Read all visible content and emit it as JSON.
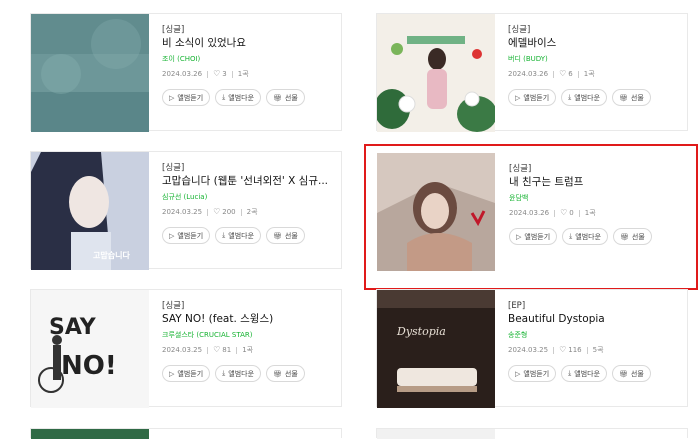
{
  "albums": [
    {
      "type": "[싱글]",
      "title": "비 소식이 있었나요",
      "artist": "조이 (CHOI)",
      "date": "2024.03.26",
      "likes": "3",
      "tracks": "1곡",
      "cover_art": "rain-cover"
    },
    {
      "type": "[싱글]",
      "title": "에델바이스",
      "artist": "버디 (BUDY)",
      "date": "2024.03.26",
      "likes": "6",
      "tracks": "1곡",
      "cover_art": "flower-cover"
    },
    {
      "type": "[싱글]",
      "title": "고맙습니다 (웹툰 '선녀외전' X 심규...",
      "artist": "심규선 (Lucia)",
      "date": "2024.03.25",
      "likes": "200",
      "tracks": "2곡",
      "cover_art": "webtoon-cover"
    },
    {
      "type": "[싱글]",
      "title": "내 친구는 트럼프",
      "artist": "윤담백",
      "date": "2024.03.26",
      "likes": "0",
      "tracks": "1곡",
      "cover_art": "portrait-cover"
    },
    {
      "type": "[싱글]",
      "title": "SAY NO! (feat. 스윙스)",
      "artist": "크루셜스타 (CRUCIAL STAR)",
      "date": "2024.03.25",
      "likes": "81",
      "tracks": "1곡",
      "cover_art": "say-no-cover"
    },
    {
      "type": "[EP]",
      "title": "Beautiful Dystopia",
      "artist": "송준형",
      "date": "2024.03.25",
      "likes": "116",
      "tracks": "5곡",
      "cover_art": "dystopia-cover"
    }
  ],
  "buttons": {
    "listen": "앨범듣기",
    "download": "앨범다운",
    "gift": "선물"
  },
  "colors": {
    "artist": "#16b332",
    "highlight": "#e01a1a"
  }
}
